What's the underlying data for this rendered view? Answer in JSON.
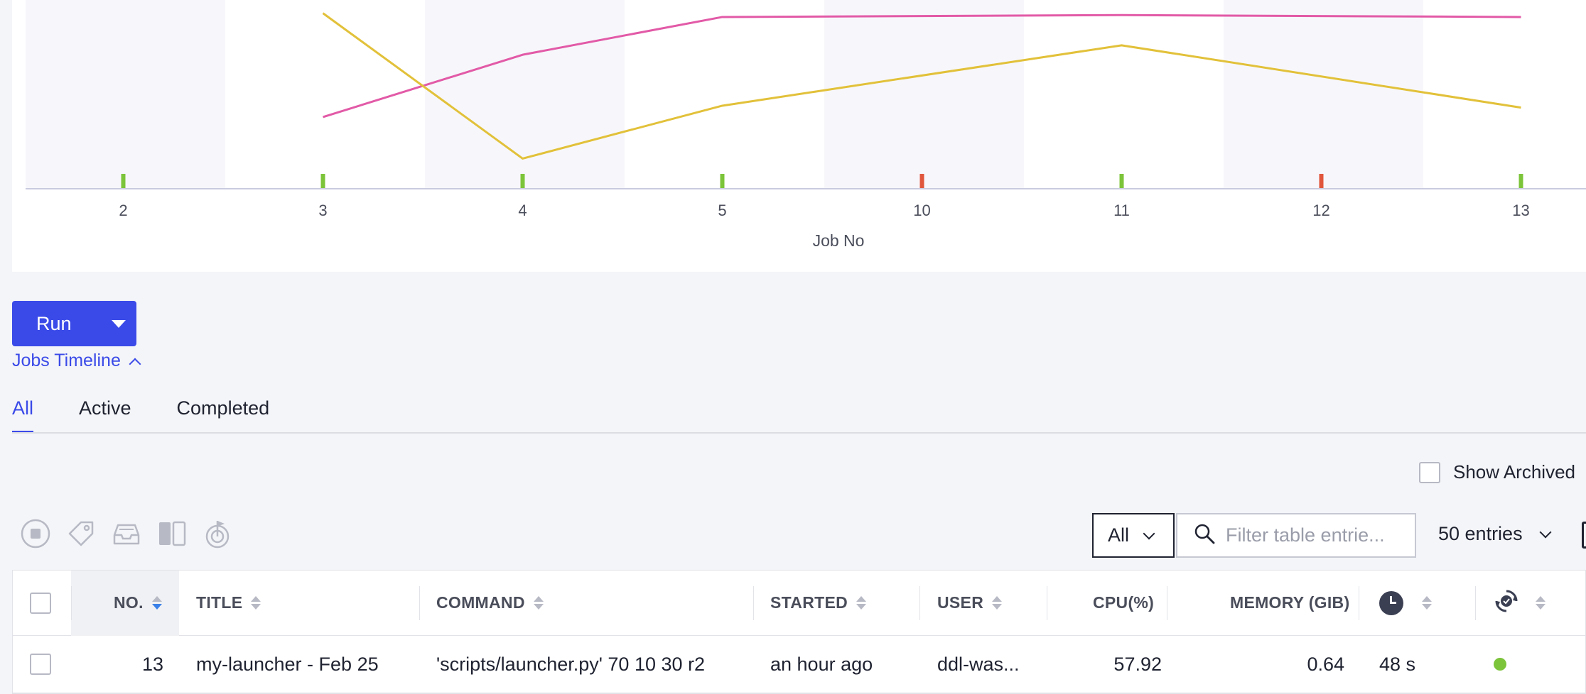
{
  "chart_data": {
    "type": "line",
    "xlabel": "Job No",
    "categories": [
      "2",
      "3",
      "4",
      "5",
      "10",
      "11",
      "12",
      "13"
    ],
    "series": [
      {
        "color": "#e25aa7",
        "values": [
          null,
          0.38,
          0.71,
          0.91,
          null,
          0.92,
          null,
          0.91
        ]
      },
      {
        "color": "#e2c13a",
        "values": [
          null,
          0.93,
          0.16,
          0.44,
          null,
          0.76,
          null,
          0.43
        ]
      }
    ],
    "status_markers": [
      "ok",
      "ok",
      "ok",
      "ok",
      "failed",
      "ok",
      "failed",
      "ok"
    ],
    "status_colors": {
      "ok": "#7cc43a",
      "failed": "#e0563c"
    },
    "grid": true
  },
  "run_button": {
    "label": "Run"
  },
  "timeline_link": {
    "label": "Jobs Timeline"
  },
  "tabs": [
    {
      "label": "All",
      "active": true
    },
    {
      "label": "Active",
      "active": false
    },
    {
      "label": "Completed",
      "active": false
    }
  ],
  "show_archived": {
    "label": "Show Archived",
    "checked": false
  },
  "toolbar": {
    "icons": [
      "stop-icon",
      "tag-icon",
      "archive-icon",
      "compare-icon",
      "target-flag-icon"
    ]
  },
  "filter": {
    "value": "All"
  },
  "search": {
    "placeholder": "Filter table entrie..."
  },
  "entries": {
    "label": "50 entries"
  },
  "table": {
    "headers": {
      "no": "NO.",
      "title": "TITLE",
      "command": "COMMAND",
      "started": "STARTED",
      "user": "USER",
      "cpu": "CPU(%)",
      "memory": "MEMORY (GIB)"
    },
    "rows": [
      {
        "no": "13",
        "title": "my-launcher - Feb 25",
        "command": "'scripts/launcher.py' 70 10 30 r2",
        "started": "an hour ago",
        "user": "ddl-was...",
        "cpu": "57.92",
        "memory": "0.64",
        "duration": "48 s",
        "status_color": "#7cc43a"
      }
    ]
  },
  "colors": {
    "accent": "#3a4ae8",
    "ok": "#7cc43a",
    "failed": "#e0563c"
  }
}
